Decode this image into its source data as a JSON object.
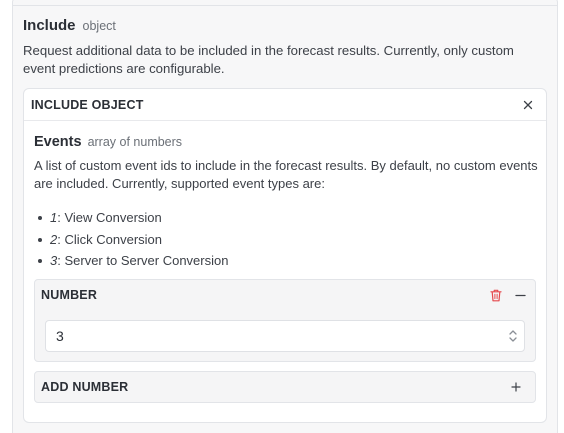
{
  "include": {
    "name": "Include",
    "type": "object",
    "description": "Request additional data to be included in the forecast results. Currently, only custom event predictions are configurable."
  },
  "include_object": {
    "title": "INCLUDE OBJECT",
    "close_icon": "close-icon"
  },
  "events": {
    "name": "Events",
    "type": "array of numbers",
    "description": "A list of custom event ids to include in the forecast results. By default, no custom events are included. Currently, supported event types are:",
    "items": [
      {
        "id": "1",
        "label": ": View Conversion"
      },
      {
        "id": "2",
        "label": ": Click Conversion"
      },
      {
        "id": "3",
        "label": ": Server to Server Conversion"
      }
    ]
  },
  "number_item": {
    "title": "NUMBER",
    "value": "3",
    "delete_icon": "trash-icon",
    "collapse_icon": "minus-icon",
    "stepper_icon": "stepper-icon"
  },
  "add_number": {
    "label": "ADD NUMBER",
    "icon": "plus-icon"
  },
  "colors": {
    "delete": "#e5484d",
    "text": "#2b2f36",
    "muted": "#6b7077",
    "border": "#e2e4e8"
  }
}
